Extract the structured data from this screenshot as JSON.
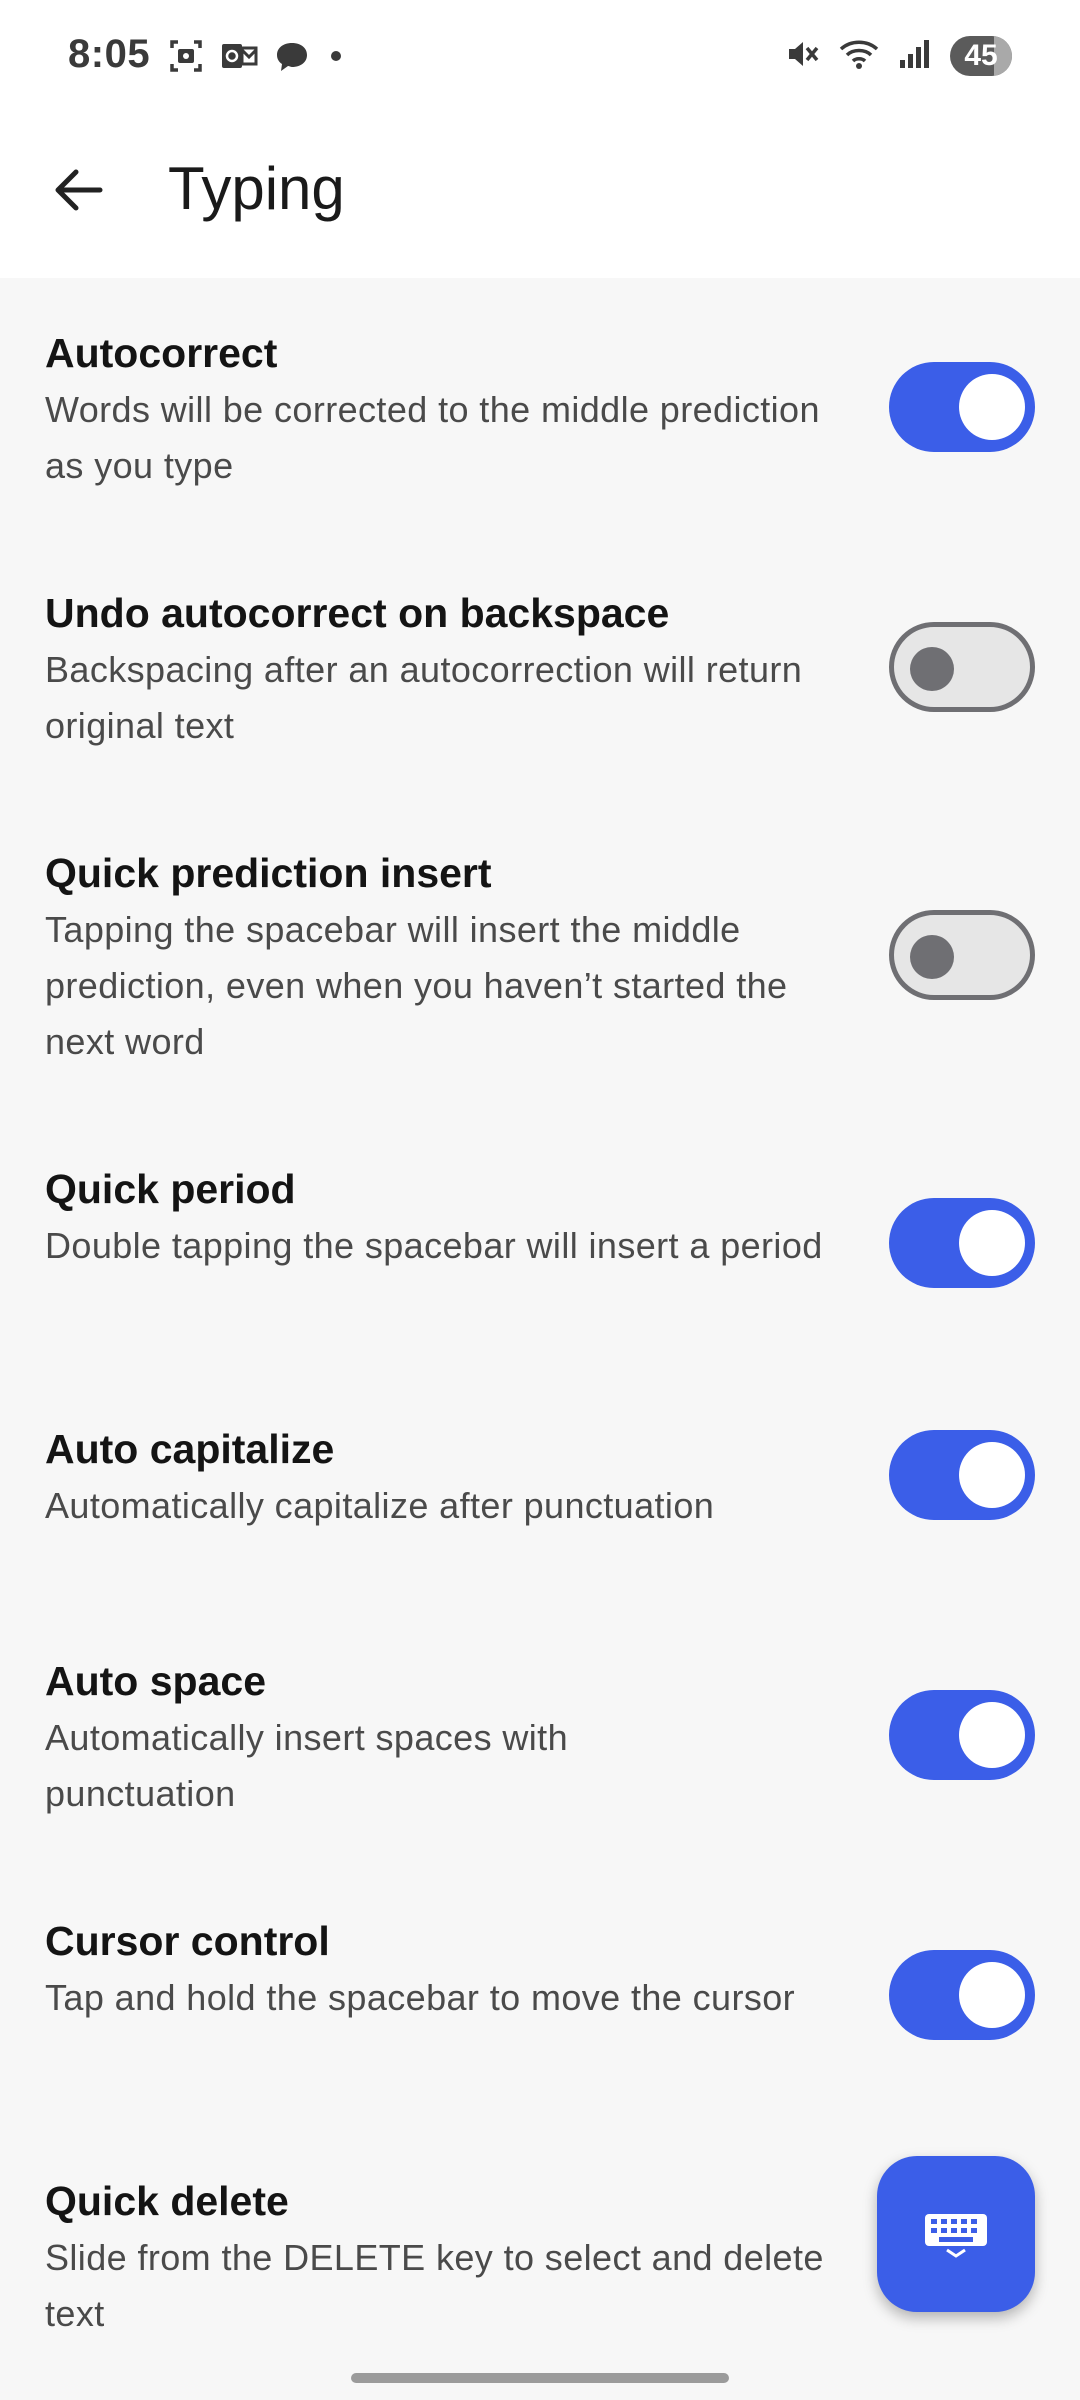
{
  "status_bar": {
    "time": "8:05",
    "left_icons": [
      "screenshot-icon",
      "outlook-icon",
      "chat-bubble-icon",
      "dot-icon"
    ],
    "right_icons": [
      "mute-icon",
      "wifi-icon",
      "cell-signal-icon"
    ],
    "battery_level": "45"
  },
  "app_bar": {
    "title": "Typing",
    "back_icon": "arrow-back-icon"
  },
  "colors": {
    "accent": "#3b5ee8",
    "toggle_off_track": "#e6e6e6",
    "toggle_off_outline": "#6f6f73",
    "background": "#f7f7f7"
  },
  "settings": [
    {
      "title": "Autocorrect",
      "description": "Words will be corrected to the middle prediction as you type",
      "enabled": true
    },
    {
      "title": "Undo autocorrect on backspace",
      "description": "Backspacing after an autocorrection will return original text",
      "enabled": false
    },
    {
      "title": "Quick prediction insert",
      "description": "Tapping the spacebar will insert the middle prediction, even when you haven’t started the next word",
      "enabled": false
    },
    {
      "title": "Quick period",
      "description": "Double tapping the spacebar will insert a period",
      "enabled": true
    },
    {
      "title": "Auto capitalize",
      "description": "Automatically capitalize after punctuation",
      "enabled": true
    },
    {
      "title": "Auto space",
      "description": "Automatically insert spaces with punctuation",
      "enabled": true
    },
    {
      "title": "Cursor control",
      "description": "Tap and hold the spacebar to move the cursor",
      "enabled": true
    },
    {
      "title": "Quick delete",
      "description": "Slide from the DELETE key to select and delete text"
    }
  ],
  "fab": {
    "icon": "keyboard-icon"
  }
}
